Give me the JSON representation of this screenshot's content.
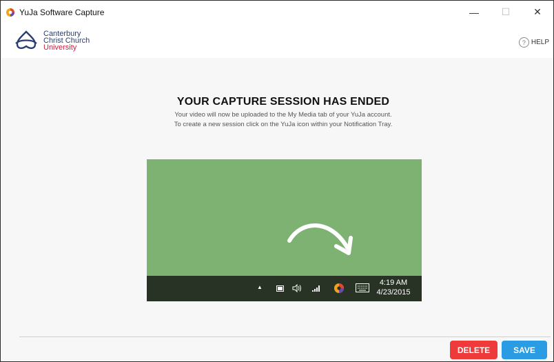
{
  "window": {
    "title": "YuJa Software Capture",
    "controls": {
      "minimize": "—",
      "maximize": "☐",
      "close": "✕"
    }
  },
  "header": {
    "logo_line1": "Canterbury",
    "logo_line2": "Christ Church",
    "logo_line3": "University",
    "help_icon": "?",
    "help_label": "HELP"
  },
  "main": {
    "heading": "YOUR CAPTURE SESSION HAS ENDED",
    "line1": "Your video will now be uploaded to the My Media tab of your YuJa account.",
    "line2": "To create a new session click on the YuJa icon within your Notification Tray.",
    "tray": {
      "up_arrow": "▲",
      "time": "4:19 AM",
      "date": "4/23/2015"
    }
  },
  "footer": {
    "delete_label": "DELETE",
    "save_label": "SAVE"
  },
  "colors": {
    "delete": "#ee3a3a",
    "save": "#2a9ce3",
    "illustration_bg": "#7db272",
    "tray_bg": "#283326",
    "logo_blue": "#2a3e73",
    "logo_red": "#c8223c"
  }
}
